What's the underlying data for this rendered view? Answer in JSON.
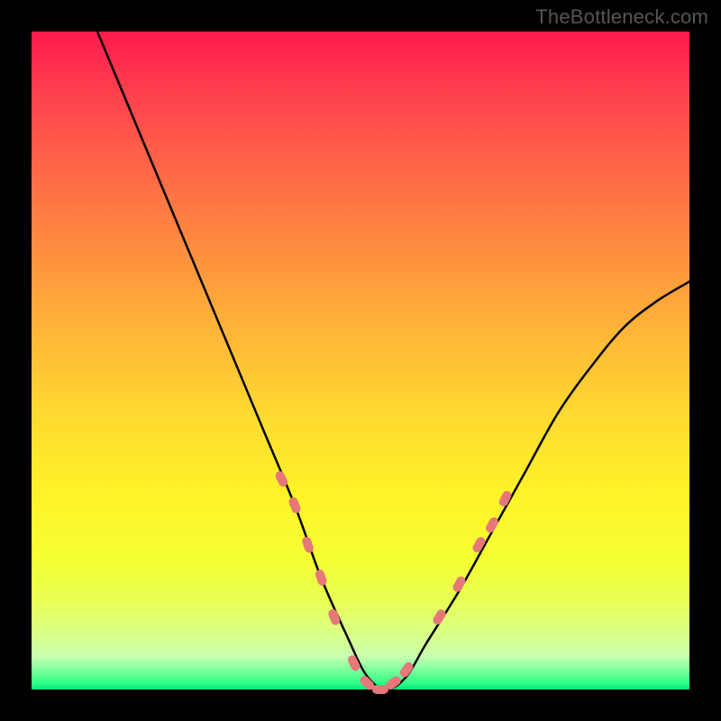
{
  "watermark": "TheBottleneck.com",
  "chart_data": {
    "type": "line",
    "title": "",
    "xlabel": "",
    "ylabel": "",
    "xlim": [
      0,
      100
    ],
    "ylim": [
      0,
      100
    ],
    "grid": false,
    "legend": false,
    "series": [
      {
        "name": "bottleneck-curve",
        "x": [
          10,
          15,
          20,
          25,
          30,
          35,
          40,
          44,
          48,
          51,
          54,
          57,
          60,
          65,
          70,
          75,
          80,
          85,
          90,
          95,
          100
        ],
        "y": [
          100,
          88,
          76,
          64,
          52,
          40,
          28,
          17,
          8,
          2,
          0,
          2,
          7,
          15,
          24,
          33,
          42,
          49,
          55,
          59,
          62
        ]
      }
    ],
    "markers": {
      "name": "highlighted-points",
      "shape": "capsule",
      "color": "#e6787a",
      "points": [
        {
          "x": 38,
          "y": 32
        },
        {
          "x": 40,
          "y": 28
        },
        {
          "x": 42,
          "y": 22
        },
        {
          "x": 44,
          "y": 17
        },
        {
          "x": 46,
          "y": 11
        },
        {
          "x": 49,
          "y": 4
        },
        {
          "x": 51,
          "y": 1
        },
        {
          "x": 53,
          "y": 0
        },
        {
          "x": 55,
          "y": 1
        },
        {
          "x": 57,
          "y": 3
        },
        {
          "x": 62,
          "y": 11
        },
        {
          "x": 65,
          "y": 16
        },
        {
          "x": 68,
          "y": 22
        },
        {
          "x": 70,
          "y": 25
        },
        {
          "x": 72,
          "y": 29
        }
      ]
    },
    "background_gradient": {
      "top": "#ff1a4d",
      "mid": "#fff228",
      "bottom": "#00e876"
    }
  }
}
